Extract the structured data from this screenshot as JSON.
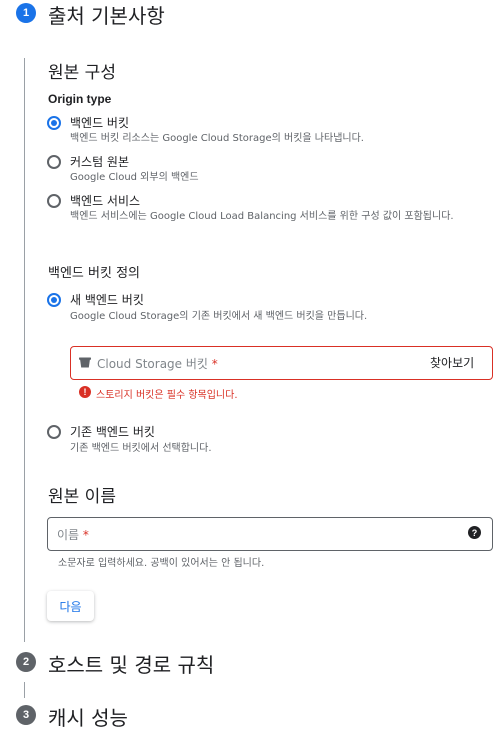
{
  "steps": [
    {
      "number": "1",
      "title": "출처 기본사항"
    },
    {
      "number": "2",
      "title": "호스트 및 경로 규칙"
    },
    {
      "number": "3",
      "title": "캐시 성능"
    }
  ],
  "origin_config": {
    "title": "원본 구성",
    "field_label": "Origin type",
    "options": [
      {
        "label": "백엔드 버킷",
        "desc": "백엔드 버킷 리소스는 Google Cloud Storage의 버킷을 나타냅니다.",
        "checked": true
      },
      {
        "label": "커스텀 원본",
        "desc": "Google Cloud 외부의 백엔드",
        "checked": false
      },
      {
        "label": "백엔드 서비스",
        "desc": "백엔드 서비스에는 Google Cloud Load Balancing 서비스를 위한 구성 값이 포함됩니다.",
        "checked": false
      }
    ]
  },
  "bucket_def": {
    "title": "백엔드 버킷 정의",
    "new_option": {
      "label": "새 백엔드 버킷",
      "desc": "Google Cloud Storage의 기존 버킷에서 새 백엔드 버킷을 만듭니다."
    },
    "storage_input": {
      "placeholder": "Cloud Storage 버킷",
      "required_mark": "*",
      "browse_label": "찾아보기"
    },
    "error_text": "스토리지 버킷은 필수 항목입니다.",
    "error_icon_glyph": "!",
    "existing_option": {
      "label": "기존 백엔드 버킷",
      "desc": "기존 백엔드 버킷에서 선택합니다."
    }
  },
  "origin_name": {
    "title": "원본 이름",
    "placeholder": "이름",
    "required_mark": "*",
    "help_glyph": "?",
    "hint": "소문자로 입력하세요. 공백이 있어서는 안 됩니다."
  },
  "next_label": "다음",
  "colors": {
    "accent": "#1a73e8",
    "error": "#d93025",
    "muted": "#5f6368"
  }
}
